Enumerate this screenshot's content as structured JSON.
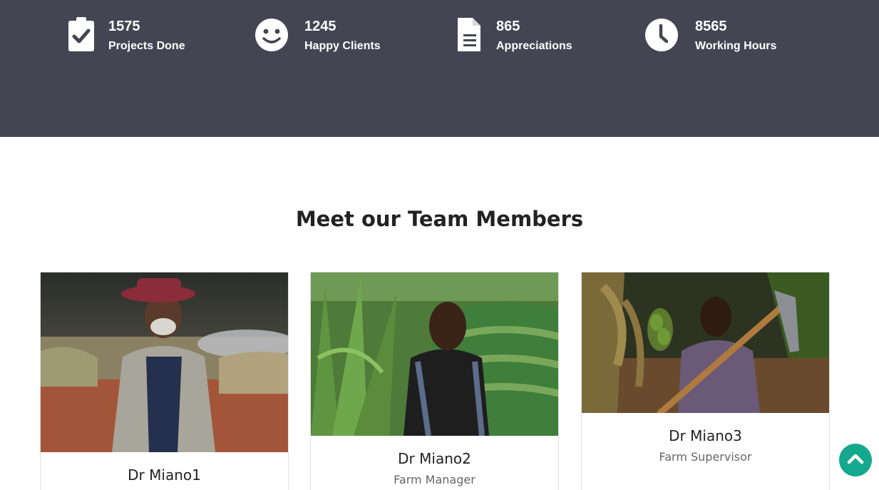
{
  "stats": [
    {
      "number": "1575",
      "label": "Projects Done",
      "icon": "clipboard-check-icon"
    },
    {
      "number": "1245",
      "label": "Happy Clients",
      "icon": "smile-icon"
    },
    {
      "number": "865",
      "label": "Appreciations",
      "icon": "document-icon"
    },
    {
      "number": "8565",
      "label": "Working Hours",
      "icon": "clock-icon"
    }
  ],
  "team": {
    "title": "Meet our Team Members",
    "members": [
      {
        "name": "Dr Miano1",
        "role": ""
      },
      {
        "name": "Dr Miano2",
        "role": "Farm Manager"
      },
      {
        "name": "Dr Miano3",
        "role": "Farm Supervisor"
      }
    ]
  },
  "colors": {
    "band": "#434552",
    "accent": "#14a88e"
  },
  "scroll_top_icon": "chevron-up-icon"
}
